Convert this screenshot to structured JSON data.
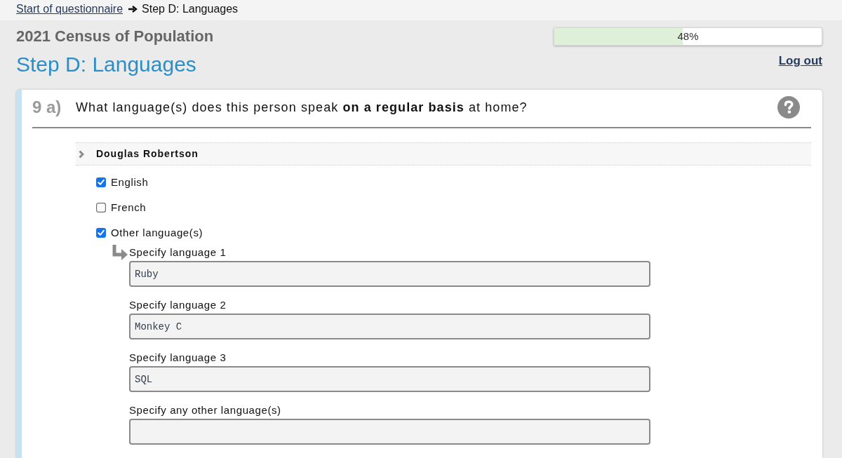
{
  "breadcrumb": {
    "link": "Start of questionnaire",
    "current": "Step D: Languages"
  },
  "header": {
    "survey_title": "2021 Census of Population",
    "step_title": "Step D: Languages",
    "progress": {
      "level": 0.48,
      "reading": "48%"
    },
    "logout_link": "Log out"
  },
  "question": {
    "number": "9 a)",
    "text": "What language(s) does this person speak **on a regular basis** at home?",
    "person": {
      "name": "Douglas Robertson"
    },
    "options": [
      {
        "label": "English",
        "checked": true
      },
      {
        "label": "French",
        "checked": false
      },
      {
        "label": "Other language(s)",
        "checked": true
      }
    ],
    "specify_fields": [
      {
        "label": "Specify language 1",
        "value": "Ruby"
      },
      {
        "label": "Specify language 2",
        "value": "Monkey C"
      },
      {
        "label": "Specify language 3",
        "value": "SQL"
      },
      {
        "label": "Specify any other language(s)"
      }
    ]
  }
}
